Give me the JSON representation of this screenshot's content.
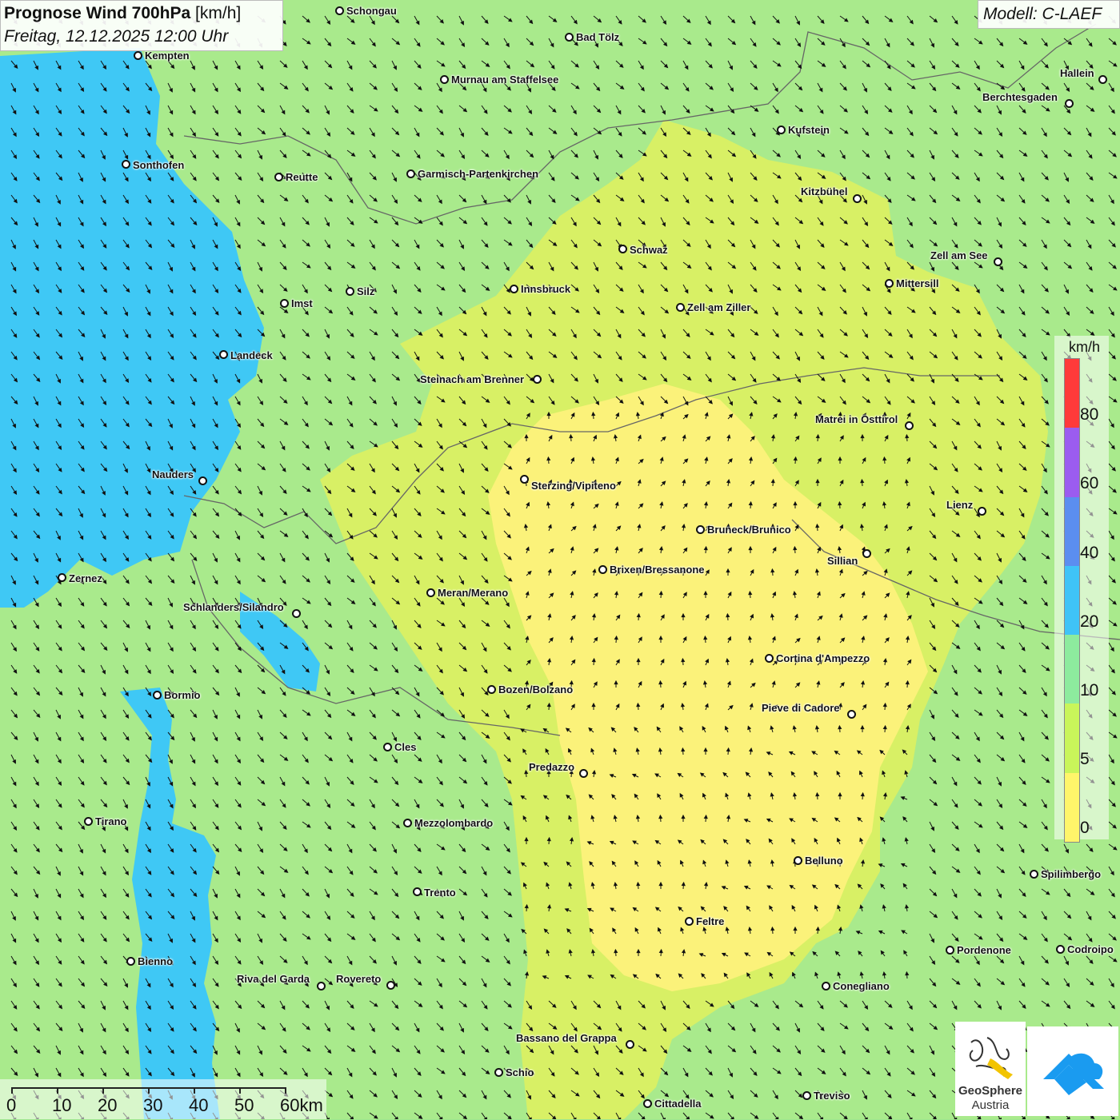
{
  "title": {
    "main": "Prognose Wind 700hPa",
    "unit": "[km/h]",
    "datetime": "Freitag, 12.12.2025 12:00 Uhr"
  },
  "model_label": "Modell: C-LAEF",
  "legend": {
    "unit": "km/h",
    "ticks": [
      "80",
      "60",
      "40",
      "20",
      "10",
      "5",
      "0"
    ],
    "colors": [
      "#ff3a3a",
      "#9b5cf0",
      "#5b8ef0",
      "#3fc3f7",
      "#8deb9e",
      "#c9f55a",
      "#fff56a"
    ]
  },
  "scalebar": {
    "labels": [
      "0",
      "10",
      "20",
      "30",
      "40",
      "50",
      "60km"
    ]
  },
  "logo": {
    "geosphere_line1": "GeoSphere",
    "geosphere_line2": "Austria"
  },
  "colors": {
    "strong_wind": "#3fc8f5",
    "moderate_wind": "#a9ea8c",
    "light_wind": "#d8f065",
    "calm": "#fbf27a"
  },
  "cities": [
    {
      "name": "Schongau"
    },
    {
      "name": "Bad Tölz"
    },
    {
      "name": "Kempten"
    },
    {
      "name": "Murnau am Staffelsee"
    },
    {
      "name": "Hallein"
    },
    {
      "name": "Berchtesgaden"
    },
    {
      "name": "Kufstein"
    },
    {
      "name": "Sonthofen"
    },
    {
      "name": "Reutte"
    },
    {
      "name": "Garmisch-Partenkirchen"
    },
    {
      "name": "Kitzbühel"
    },
    {
      "name": "Schwaz"
    },
    {
      "name": "Zell am See"
    },
    {
      "name": "Mittersill"
    },
    {
      "name": "Innsbruck"
    },
    {
      "name": "Zell am Ziller"
    },
    {
      "name": "Silz"
    },
    {
      "name": "Imst"
    },
    {
      "name": "Landeck"
    },
    {
      "name": "Steinach am Brenner"
    },
    {
      "name": "Matrei in Osttirol"
    },
    {
      "name": "Nauders"
    },
    {
      "name": "Sterzing/Vipiteno"
    },
    {
      "name": "Lienz"
    },
    {
      "name": "Bruneck/Brunico"
    },
    {
      "name": "Sillian"
    },
    {
      "name": "Zernez"
    },
    {
      "name": "Brixen/Bressanone"
    },
    {
      "name": "Meran/Merano"
    },
    {
      "name": "Schlanders/Silandro"
    },
    {
      "name": "Cortina d'Ampezzo"
    },
    {
      "name": "Bormio"
    },
    {
      "name": "Bozen/Bolzano"
    },
    {
      "name": "Pieve di Cadore"
    },
    {
      "name": "Cles"
    },
    {
      "name": "Predazzo"
    },
    {
      "name": "Tirano"
    },
    {
      "name": "Mezzolombardo"
    },
    {
      "name": "Belluno"
    },
    {
      "name": "Spilimbergo"
    },
    {
      "name": "Trento"
    },
    {
      "name": "Feltre"
    },
    {
      "name": "Pordenone"
    },
    {
      "name": "Codroipo"
    },
    {
      "name": "Bienno"
    },
    {
      "name": "Riva del Garda"
    },
    {
      "name": "Rovereto"
    },
    {
      "name": "Conegliano"
    },
    {
      "name": "Bassano del Grappa"
    },
    {
      "name": "Schio"
    },
    {
      "name": "Treviso"
    },
    {
      "name": "Cittadella"
    }
  ]
}
